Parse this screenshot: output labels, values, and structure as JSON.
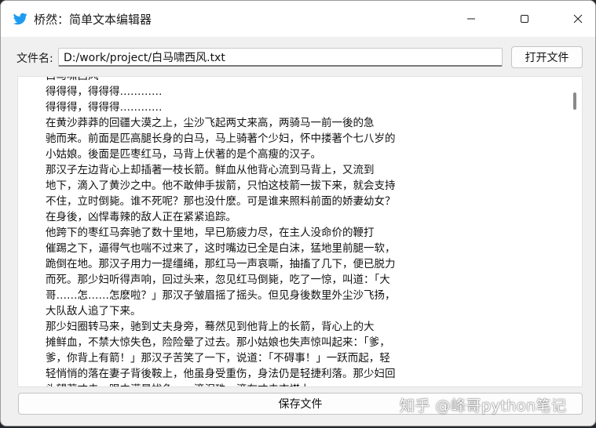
{
  "window": {
    "title": "桥然：简单文本编辑器",
    "icon": "bird-icon",
    "accent_color": "#1d9bf0"
  },
  "file_bar": {
    "label": "文件名:",
    "path_value": "D:/work/project/白马啸西风.txt",
    "open_button_label": "打开文件"
  },
  "editor": {
    "lines": [
      "白马啸西风",
      "得得得，得得得…………",
      "得得得，得得得…………",
      "在黄沙莽莽的回疆大漠之上，尘沙飞起两丈来高，两骑马一前一後的急",
      "驰而来。前面是匹高腿长身的白马，马上骑著个少妇，怀中搂著个七八岁的",
      "小姑娘。後面是匹枣红马，马背上伏著的是个高瘦的汉子。",
      "那汉子左边背心上却插著一枝长箭。鲜血从他背心流到马背上，又流到",
      "地下，滴入了黄沙之中。他不敢伸手拔箭，只怕这枝箭一拔下来，就会支持",
      "不住，立时倒毙。谁不死呢？那也没什麽。可是谁来照料前面的娇妻幼女？",
      "在身後，凶悍毒辣的敌人正在紧紧追踪。",
      "他跨下的枣红马奔驰了数十里地，早已筋疲力尽，在主人没命价的鞭打",
      "催踢之下，逼得气也喘不过来了，这时嘴边已全是白沫，猛地里前腿一软，",
      "跪倒在地。那汉子用力一提缰绳，那红马一声哀嘶，抽搐了几下，便已脱力",
      "而死。那少妇听得声响，回过头来，忽见红马倒毙，吃了一惊，叫道：「大",
      "哥……怎……怎麽啦？」那汉子皱眉摇了摇头。但见身後数里外尘沙飞扬，",
      "大队敌人追了下来。",
      "那少妇圈转马来，驰到丈夫身旁，蓦然见到他背上的长箭，背心上的大",
      "摊鲜血，不禁大惊失色，险险晕了过去。那小姑娘也失声惊叫起来：「爹，",
      "爹，你背上有箭！」那汉子苦笑了一下，说道：「不碍事！」一跃而起，轻",
      "轻悄悄的落在妻子背後鞍上，他虽身受重伤，身法仍是轻捷利落。那少妇回",
      "头望著丈夫，眼中满是忧色，一滴泪珠，滴在丈夫衣襟上。"
    ]
  },
  "save_button_label": "保存文件",
  "watermark": "知乎 @峰哥python笔记"
}
